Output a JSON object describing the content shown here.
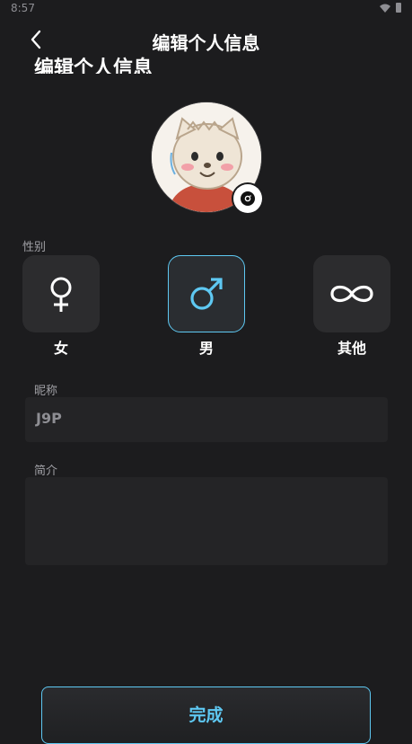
{
  "status": {
    "time": "8:57"
  },
  "header": {
    "title": "编辑个人信息",
    "ghost_title": "编辑个人信息"
  },
  "avatar": {
    "edit_icon": "camera-icon"
  },
  "gender": {
    "label": "性别",
    "options": [
      {
        "label": "女",
        "icon": "female-icon",
        "selected": false
      },
      {
        "label": "男",
        "icon": "male-icon",
        "selected": true
      },
      {
        "label": "其他",
        "icon": "infinity-icon",
        "selected": false
      }
    ]
  },
  "nickname": {
    "label": "昵称",
    "value": "J9P"
  },
  "bio": {
    "label": "简介",
    "value": ""
  },
  "actions": {
    "done": "完成"
  },
  "colors": {
    "background": "#1c1c1e",
    "accent": "#5ec8f2",
    "card": "#2c2c2e"
  }
}
